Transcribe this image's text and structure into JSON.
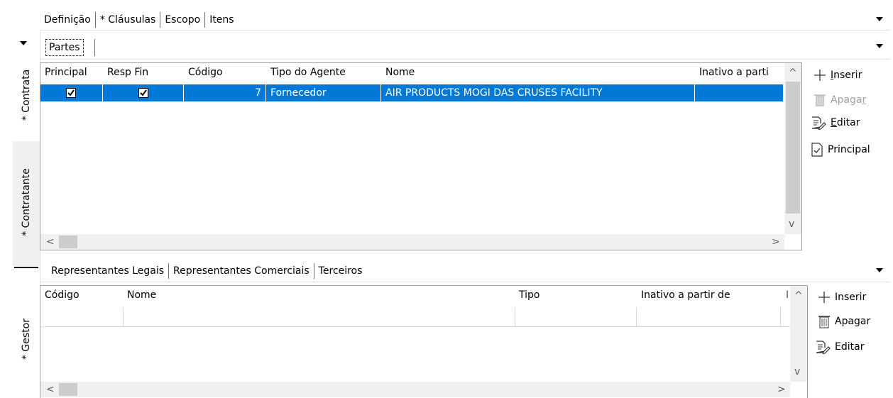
{
  "top_tabs": [
    {
      "label": "Definição",
      "selected": true
    },
    {
      "label": "* Cláusulas"
    },
    {
      "label": "Escopo"
    },
    {
      "label": "Itens"
    }
  ],
  "vertical_tabs": {
    "contrata": "* Contrata",
    "contratante": "* Contratante",
    "gestor": "* Gestor"
  },
  "partes": {
    "tab_label": "Partes",
    "columns": [
      "Principal",
      "Resp Fin",
      "Código",
      "Tipo do Agente",
      "Nome",
      "Inativo a parti"
    ],
    "rows": [
      {
        "principal": true,
        "resp_fin": true,
        "codigo": "7",
        "tipo": "Fornecedor",
        "nome": "AIR PRODUCTS MOGI DAS CRUSES FACILITY",
        "inativo": ""
      }
    ],
    "actions": {
      "insert_pre": "",
      "insert_u": "I",
      "insert_post": "nserir",
      "delete_pre": "Apaga",
      "delete_u": "r",
      "delete_post": "",
      "edit_pre": "",
      "edit_u": "E",
      "edit_post": "ditar",
      "principal": "Principal"
    }
  },
  "representantes": {
    "tabs": [
      {
        "label": "Representantes Legais",
        "selected": true
      },
      {
        "label": "Representantes Comerciais"
      },
      {
        "label": "Terceiros"
      }
    ],
    "columns": [
      "Código",
      "Nome",
      "Tipo",
      "Inativo a partir de",
      "I"
    ],
    "actions": {
      "insert": "Inserir",
      "delete": "Apagar",
      "edit": "Editar"
    }
  },
  "colors": {
    "selection": "#0078d7",
    "grid_border": "#a0a0a0",
    "disabled_text": "#a0a0a0"
  }
}
